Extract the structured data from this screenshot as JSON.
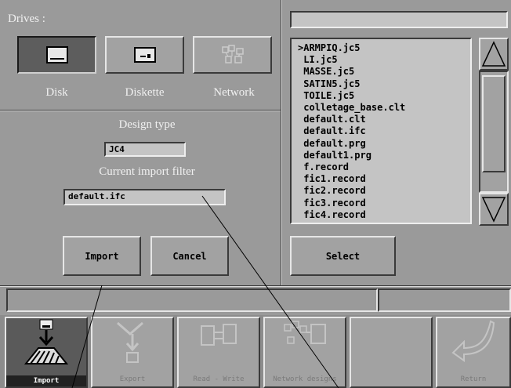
{
  "drives": {
    "title": "Drives :",
    "items": [
      {
        "label": "Disk",
        "icon": "hard-disk-icon",
        "selected": true
      },
      {
        "label": "Diskette",
        "icon": "diskette-icon",
        "selected": false
      },
      {
        "label": "Network",
        "icon": "network-icon",
        "selected": false
      }
    ]
  },
  "design_type": {
    "label": "Design type",
    "value": "JC4"
  },
  "import_filter": {
    "label": "Current import filter",
    "value": "default.ifc"
  },
  "buttons": {
    "import": "Import",
    "cancel": "Cancel",
    "select": "Select"
  },
  "path_field": {
    "value": ""
  },
  "file_list": {
    "items": [
      ">ARMPIQ.jc5",
      " LI.jc5",
      " MASSE.jc5",
      " SATIN5.jc5",
      " TOILE.jc5",
      " colletage_base.clt",
      " default.clt",
      " default.ifc",
      " default.prg",
      " default1.prg",
      " f.record",
      " fic1.record",
      " fic2.record",
      " fic3.record",
      " fic4.record"
    ]
  },
  "toolbar": {
    "items": [
      {
        "label": "Import",
        "icon": "import-icon",
        "active": true
      },
      {
        "label": "Export",
        "icon": "export-icon",
        "active": false
      },
      {
        "label": "Read - Write",
        "icon": "read-write-icon",
        "active": false
      },
      {
        "label": "Network designs",
        "icon": "network-designs-icon",
        "active": false
      },
      {
        "label": "",
        "icon": "",
        "active": false
      },
      {
        "label": "Return",
        "icon": "return-arrow-icon",
        "active": false
      }
    ]
  },
  "colors": {
    "background": "#9a9a9a",
    "panel_dark": "#3a3a3a",
    "highlight": "#e6e6e6"
  }
}
